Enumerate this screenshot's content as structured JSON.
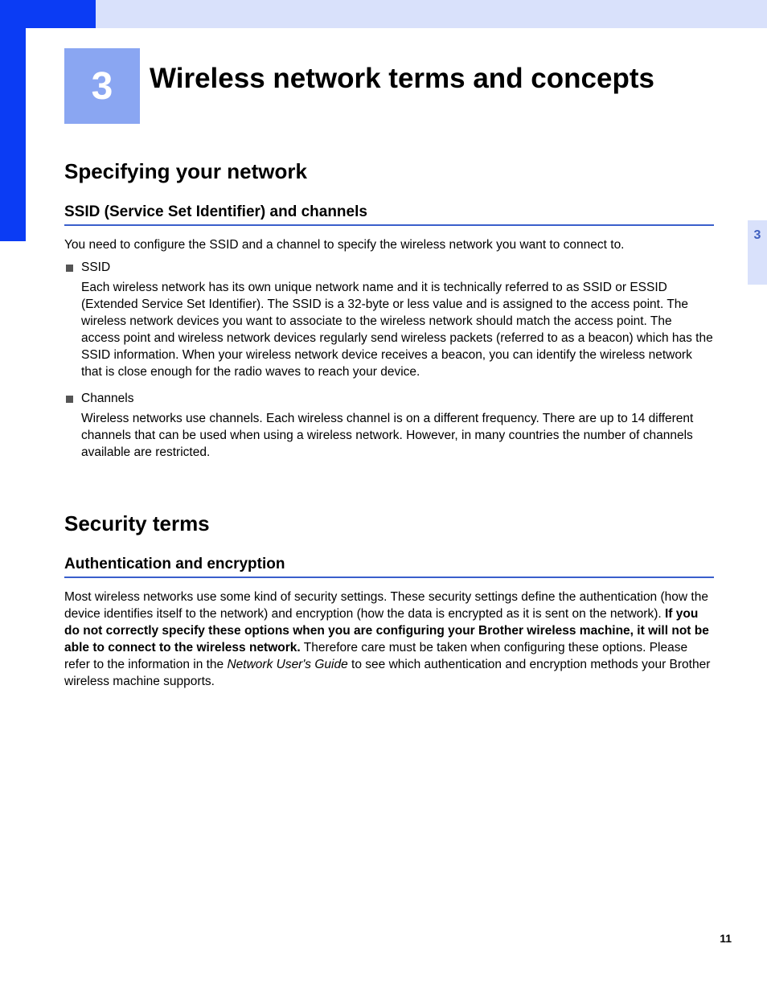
{
  "chapter": {
    "number": "3",
    "title": "Wireless network terms and concepts"
  },
  "side_tab": "3",
  "page_number": "11",
  "section1": {
    "heading": "Specifying your network",
    "sub1": {
      "heading": "SSID (Service Set Identifier) and channels",
      "intro": "You need to configure the SSID and a channel to specify the wireless network you want to connect to.",
      "bullet_a_label": "SSID",
      "bullet_a_body": "Each wireless network has its own unique network name and it is technically referred to as SSID or ESSID (Extended Service Set Identifier). The SSID is a 32-byte or less value and is assigned to the access point. The wireless network devices you want to associate to the wireless network should match the access point. The access point and wireless network devices regularly send wireless packets (referred to as a beacon) which has the SSID information. When your wireless network device receives a beacon, you can identify the wireless network that is close enough for the radio waves to reach your device.",
      "bullet_b_label": "Channels",
      "bullet_b_body": "Wireless networks use channels. Each wireless channel is on a different frequency. There are up to 14 different channels that can be used when using a wireless network. However, in many countries the number of channels available are restricted."
    }
  },
  "section2": {
    "heading": "Security terms",
    "sub1": {
      "heading": "Authentication and encryption",
      "body_pre": "Most wireless networks use some kind of security settings. These security settings define the authentication (how the device identifies itself to the network) and encryption (how the data is encrypted as it is sent on the network). ",
      "body_bold": "If you do not correctly specify these options when you are configuring your Brother wireless machine, it will not be able to connect to the wireless network.",
      "body_mid": " Therefore care must be taken when configuring these options. Please refer to the information in the ",
      "body_ital": "Network User's Guide",
      "body_post": " to see which authentication and encryption methods your Brother wireless machine supports."
    }
  }
}
